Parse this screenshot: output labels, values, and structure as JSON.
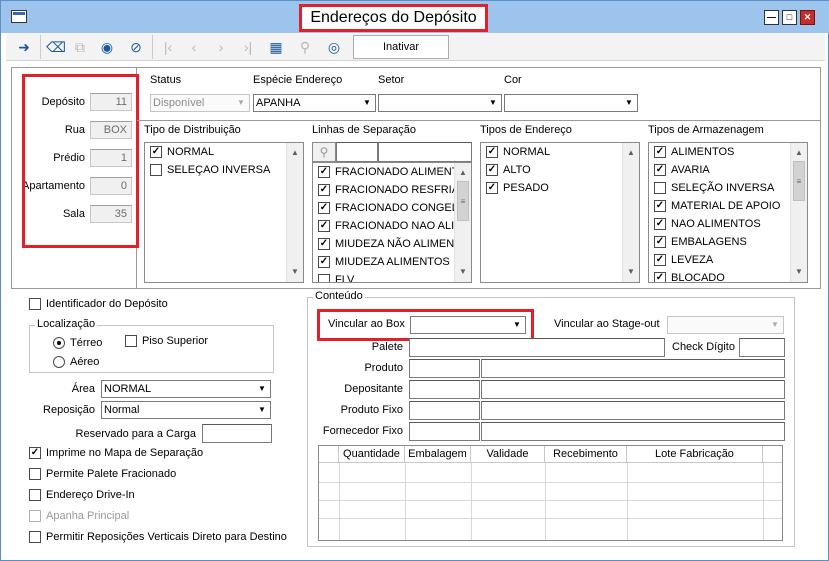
{
  "window": {
    "title": "Endereços do Depósito"
  },
  "toolbar": {
    "inativar_label": "Inativar"
  },
  "location": {
    "deposito_label": "Depósito",
    "deposito_value": "11",
    "rua_label": "Rua",
    "rua_value": "BOX",
    "predio_label": "Prédio",
    "predio_value": "1",
    "apartamento_label": "Apartamento",
    "apartamento_value": "0",
    "sala_label": "Sala",
    "sala_value": "35"
  },
  "top": {
    "status_label": "Status",
    "status_value": "Disponível",
    "especie_label": "Espécie Endereço",
    "especie_value": "APANHA",
    "setor_label": "Setor",
    "setor_value": "",
    "cor_label": "Cor",
    "cor_value": ""
  },
  "lists": {
    "distribuicao": {
      "label": "Tipo de Distribuição",
      "items": [
        {
          "text": "NORMAL",
          "checked": true
        },
        {
          "text": "SELEÇAO INVERSA",
          "checked": false
        }
      ]
    },
    "linhas": {
      "label": "Linhas de Separação",
      "items": [
        {
          "text": "FRACIONADO ALIMENT",
          "checked": true
        },
        {
          "text": "FRACIONADO RESFRIA",
          "checked": true
        },
        {
          "text": "FRACIONADO CONGELA",
          "checked": true
        },
        {
          "text": "FRACIONADO NAO ALIM",
          "checked": true
        },
        {
          "text": "MIUDEZA NÃO ALIMENT",
          "checked": true
        },
        {
          "text": "MIUDEZA ALIMENTOS",
          "checked": true
        },
        {
          "text": "FLV",
          "checked": false
        }
      ]
    },
    "tipos_endereco": {
      "label": "Tipos de Endereço",
      "items": [
        {
          "text": "NORMAL",
          "checked": true
        },
        {
          "text": "ALTO",
          "checked": true
        },
        {
          "text": "PESADO",
          "checked": true
        }
      ]
    },
    "armazenagem": {
      "label": "Tipos de Armazenagem",
      "items": [
        {
          "text": "ALIMENTOS",
          "checked": true
        },
        {
          "text": "AVARIA",
          "checked": true
        },
        {
          "text": "SELEÇÃO INVERSA",
          "checked": false
        },
        {
          "text": "MATERIAL DE APOIO",
          "checked": true
        },
        {
          "text": "NAO ALIMENTOS",
          "checked": true
        },
        {
          "text": "EMBALAGENS",
          "checked": true
        },
        {
          "text": "LEVEZA",
          "checked": true
        },
        {
          "text": "BLOCADO",
          "checked": true
        }
      ]
    }
  },
  "left": {
    "identificador_label": "Identificador do Depósito",
    "localizacao_label": "Localização",
    "terreo_label": "Térreo",
    "aereo_label": "Aéreo",
    "piso_superior_label": "Piso Superior",
    "area_label": "Área",
    "area_value": "NORMAL",
    "reposicao_label": "Reposição",
    "reposicao_value": "Normal",
    "reservado_label": "Reservado para a Carga",
    "reservado_value": "",
    "imprime_label": "Imprime no Mapa de Separação",
    "palete_fracionado_label": "Permite Palete Fracionado",
    "drive_in_label": "Endereço Drive-In",
    "apanha_principal_label": "Apanha Principal",
    "reposicoes_label": "Permitir Reposições Verticais Direto para Destino"
  },
  "conteudo": {
    "group_label": "Conteúdo",
    "box_label": "Vincular ao Box",
    "box_value": "",
    "stage_label": "Vincular ao Stage-out",
    "stage_value": "",
    "palete_label": "Palete",
    "check_label": "Check Dígito",
    "produto_label": "Produto",
    "depositante_label": "Depositante",
    "produto_fixo_label": "Produto Fixo",
    "fornecedor_label": "Fornecedor Fixo",
    "grid_headers": [
      "Quantidade",
      "Embalagem",
      "Validade",
      "Recebimento",
      "Lote Fabricação"
    ]
  },
  "colors": {
    "highlight": "#e0202a",
    "titlebar": "#9cc4ec"
  }
}
